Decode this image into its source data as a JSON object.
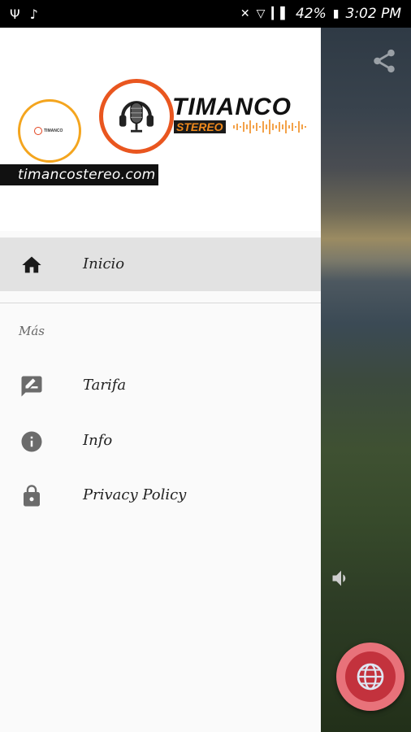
{
  "status_bar": {
    "left_icons": [
      "usb-icon",
      "music-icon"
    ],
    "battery": "42%",
    "time": "3:02 PM"
  },
  "header": {
    "logo_small_text": "TIMANCO",
    "logo_title": "TIMANCO",
    "logo_subtitle": "STEREO",
    "site_url": "timancostereo.com"
  },
  "menu": {
    "home_label": "Inicio",
    "section_title": "Más",
    "items": [
      {
        "label": "Tarifa",
        "icon": "rate-review-icon"
      },
      {
        "label": "Info",
        "icon": "info-icon"
      },
      {
        "label": "Privacy Policy",
        "icon": "lock-icon"
      }
    ]
  },
  "colors": {
    "accent_orange": "#e9561f",
    "fab_red": "#c3323d",
    "drawer_bg": "#fafafa",
    "selected_bg": "#e2e2e2"
  }
}
